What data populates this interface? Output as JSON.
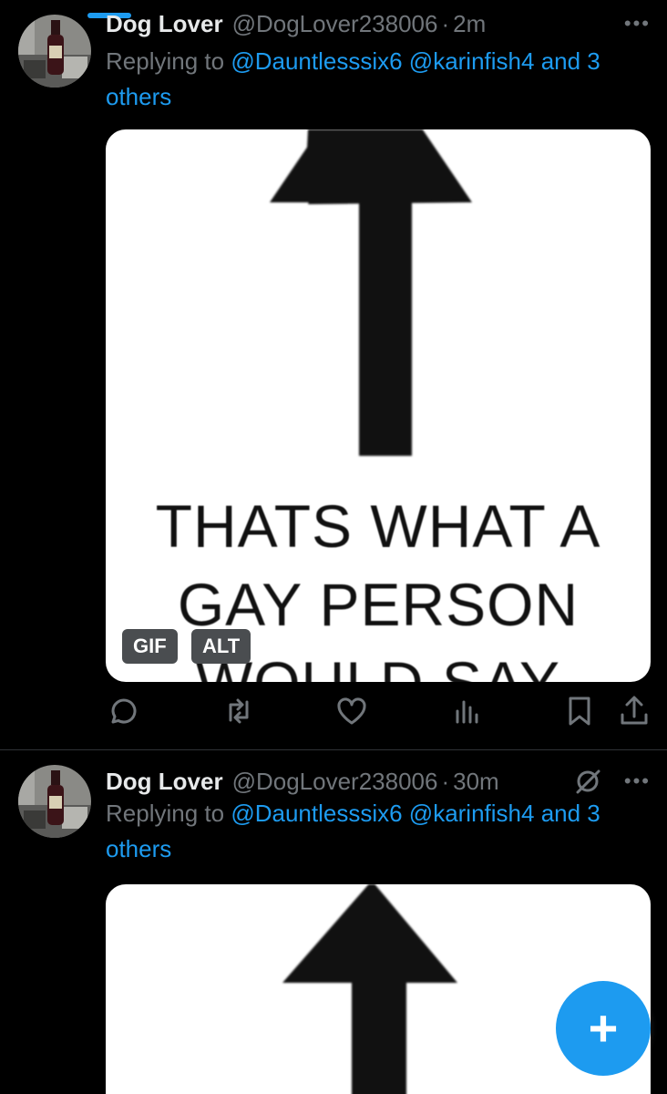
{
  "tweets": [
    {
      "author_name": "Dog Lover",
      "author_handle": "@DogLover238006",
      "separator": "·",
      "time": "2m",
      "replying_prefix": "Replying to",
      "mentions": [
        "@Dauntlesssix6",
        "@karinfish4"
      ],
      "and_others": "and 3 others",
      "media_text": [
        "THATS WHAT A",
        "GAY PERSON",
        "WOULD SAY"
      ],
      "badges": {
        "gif": "GIF",
        "alt": "ALT"
      }
    },
    {
      "author_name": "Dog Lover",
      "author_handle": "@DogLover238006",
      "separator": "·",
      "time": "30m",
      "replying_prefix": "Replying to",
      "mentions": [
        "@Dauntlesssix6",
        "@karinfish4"
      ],
      "and_others": "and 3 others"
    }
  ],
  "icons": {
    "reply": "reply-icon",
    "retweet": "retweet-icon",
    "like": "like-icon",
    "views": "views-icon",
    "bookmark": "bookmark-icon",
    "share": "share-icon",
    "more": "more-icon",
    "grok": "grok-icon",
    "compose": "compose-icon"
  },
  "fab": {
    "label": "+"
  },
  "colors": {
    "accent": "#1d9bf0",
    "muted": "#71767b",
    "background": "#000000",
    "text": "#e7e9ea"
  }
}
